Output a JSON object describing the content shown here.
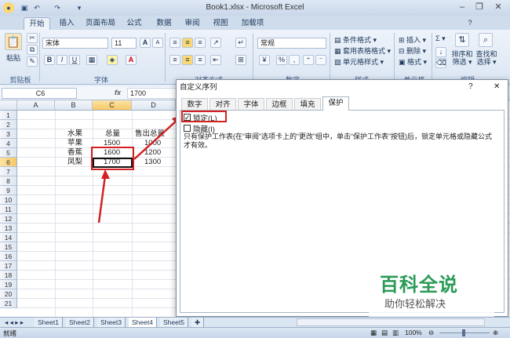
{
  "window": {
    "title": "Book1.xlsx - Microsoft Excel",
    "quick_access": [
      "save-icon",
      "undo-icon",
      "redo-icon"
    ],
    "controls": {
      "minimize": "–",
      "restore": "❐",
      "close": "✕"
    }
  },
  "ribbon": {
    "tabs": [
      "开始",
      "插入",
      "页面布局",
      "公式",
      "数据",
      "审阅",
      "视图",
      "加载项"
    ],
    "active_tab": "开始",
    "paste_label": "粘贴",
    "font_name": "宋体",
    "font_size": "11",
    "grow_font": "A",
    "shrink_font": "A",
    "bold": "B",
    "italic": "I",
    "underline": "U",
    "number_format": "常规",
    "percent": "%",
    "comma": ",",
    "conditional_format": "条件格式 ▾",
    "table_format": "套用表格格式 ▾",
    "cell_style": "单元格样式 ▾",
    "insert": "插入 ▾",
    "delete": "删除 ▾",
    "format": "格式 ▾",
    "sigma": "Σ ▾",
    "sort_filter": "排序和\n筛选 ▾",
    "find_select": "查找和\n选择 ▾",
    "groups": {
      "clipboard": "剪贴板",
      "font": "字体",
      "alignment": "对齐方式",
      "number": "数字",
      "styles": "样式",
      "cells": "单元格",
      "editing": "编辑"
    }
  },
  "formula_bar": {
    "name_box": "C6",
    "fx": "fx",
    "value": "1700"
  },
  "sheet": {
    "columns": [
      "A",
      "B",
      "C",
      "D"
    ],
    "selected_column": "C",
    "rows": [
      "1",
      "2",
      "3",
      "4",
      "5",
      "6",
      "7",
      "8",
      "9",
      "10",
      "11",
      "12",
      "13",
      "14",
      "15",
      "16",
      "17",
      "18",
      "19",
      "20",
      "21"
    ],
    "selected_row": "6",
    "cells": {
      "b3": "水果",
      "c3": "总量",
      "d3": "售出总量",
      "b4": "苹果",
      "c4": "1500",
      "d4": "1000",
      "b5": "香蕉",
      "c5": "1600",
      "d5": "1200",
      "b6": "凤梨",
      "c6": "1700",
      "d6": "1300"
    }
  },
  "sheet_tabs": [
    "Sheet1",
    "Sheet2",
    "Sheet3",
    "Sheet4",
    "Sheet5"
  ],
  "active_sheet": "Sheet4",
  "status": {
    "ready": "就绪",
    "zoom": "100%"
  },
  "dialog": {
    "title": "自定义序列",
    "help": "?",
    "close": "✕",
    "tabs": [
      "数字",
      "对齐",
      "字体",
      "边框",
      "填充",
      "保护"
    ],
    "active_tab": "保护",
    "locked_label": "锁定(L)",
    "locked_checked": true,
    "hidden_label": "隐藏(I)",
    "hidden_checked": false,
    "description": "只有保护工作表(在“审阅”选项卡上的“更改”组中，单击“保护工作表”按钮)后，锁定单元格或隐藏公式才有效。"
  },
  "watermark": {
    "line1": "百科全说",
    "line2": "助你轻松解决"
  },
  "colors": {
    "annotation_red": "#d42020",
    "selection_orange": "#f8c766",
    "ribbon_blue": "#dbe6f3"
  }
}
